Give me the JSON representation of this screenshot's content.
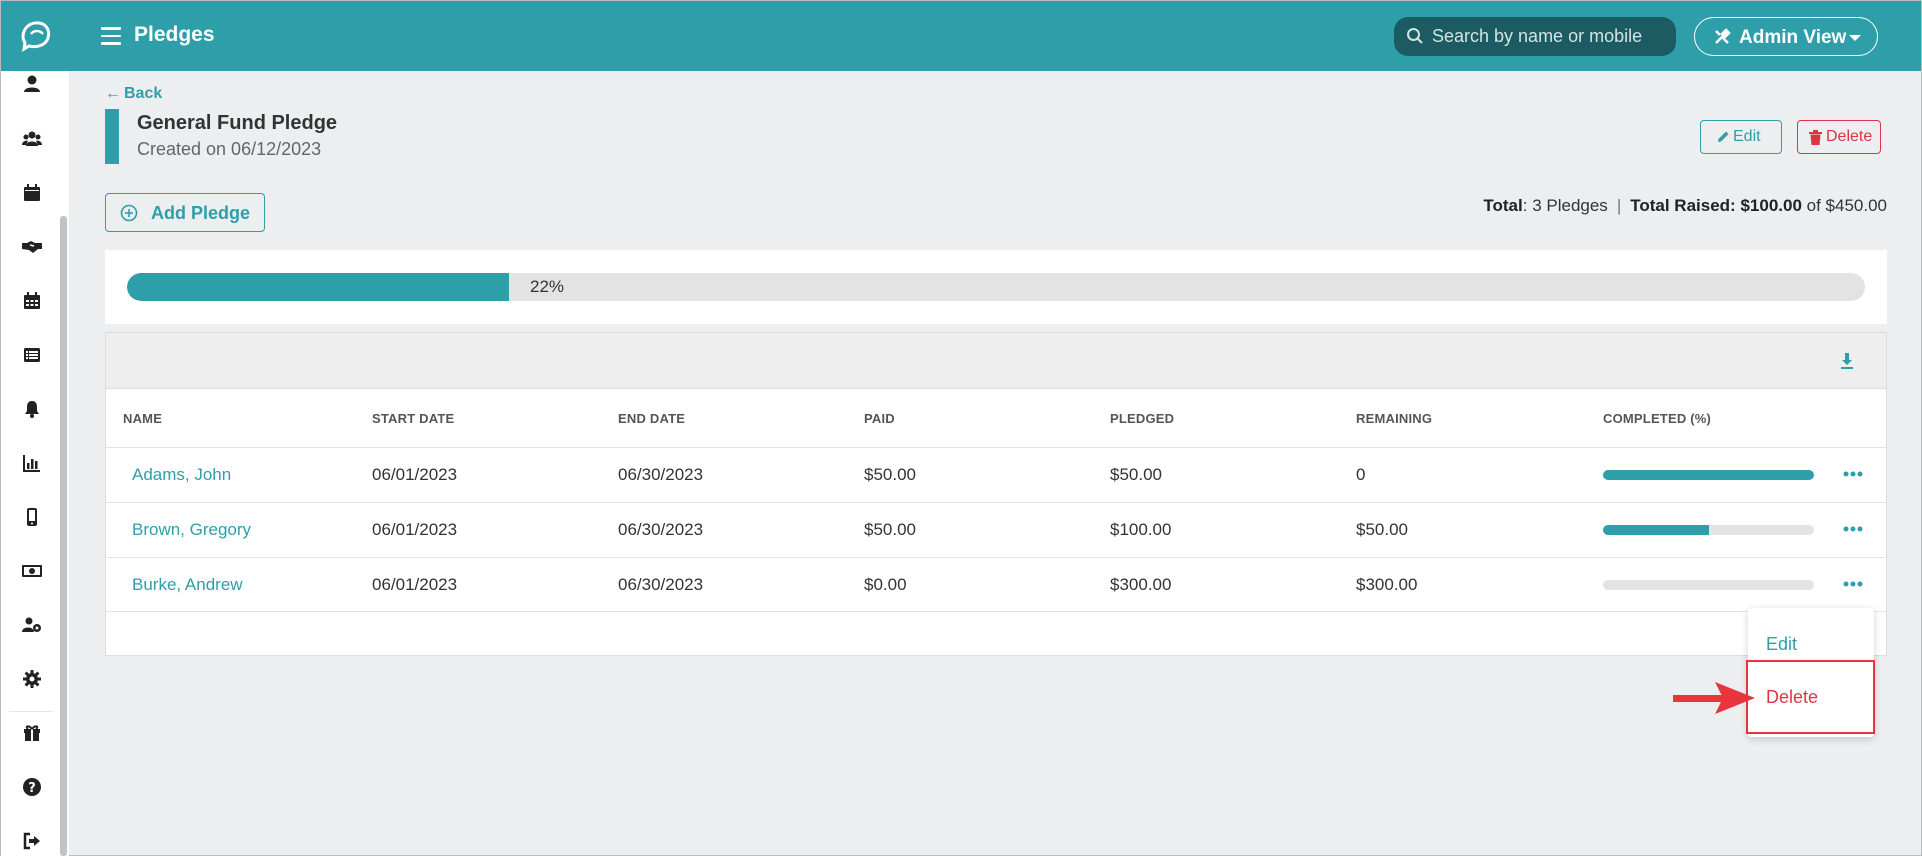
{
  "header": {
    "title": "Pledges",
    "search_placeholder": "Search by name or mobile",
    "admin_view_label": "Admin View"
  },
  "sidebar": {
    "items": [
      {
        "icon": "user-icon"
      },
      {
        "icon": "users-icon"
      },
      {
        "icon": "calendar-icon"
      },
      {
        "icon": "handshake-icon"
      },
      {
        "icon": "calendar-grid-icon"
      },
      {
        "icon": "list-icon"
      },
      {
        "icon": "bell-icon"
      },
      {
        "icon": "chart-icon"
      },
      {
        "icon": "mobile-icon"
      },
      {
        "icon": "money-icon"
      },
      {
        "icon": "user-gear-icon"
      },
      {
        "icon": "settings-icon"
      },
      {
        "icon": "gift-icon"
      },
      {
        "icon": "help-icon"
      },
      {
        "icon": "logout-icon"
      }
    ]
  },
  "page": {
    "back_label": "Back",
    "pledge_title": "General Fund Pledge",
    "created_text": "Created on 06/12/2023",
    "edit_label": "Edit",
    "delete_label": "Delete",
    "add_pledge_label": "Add Pledge",
    "totals": {
      "total_label": "Total",
      "total_value": ": 3 Pledges",
      "separator": "|",
      "raised_label": "Total Raised:",
      "raised_value": "$100.00",
      "of_text": "of $450.00"
    },
    "progress": {
      "percent": 22,
      "label": "22%"
    }
  },
  "table": {
    "columns": [
      "NAME",
      "START DATE",
      "END DATE",
      "PAID",
      "PLEDGED",
      "REMAINING",
      "COMPLETED (%)"
    ],
    "rows": [
      {
        "name": "Adams, John",
        "start": "06/01/2023",
        "end": "06/30/2023",
        "paid": "$50.00",
        "pledged": "$50.00",
        "remaining": "0",
        "completed": 100
      },
      {
        "name": "Brown, Gregory",
        "start": "06/01/2023",
        "end": "06/30/2023",
        "paid": "$50.00",
        "pledged": "$100.00",
        "remaining": "$50.00",
        "completed": 50
      },
      {
        "name": "Burke, Andrew",
        "start": "06/01/2023",
        "end": "06/30/2023",
        "paid": "$0.00",
        "pledged": "$300.00",
        "remaining": "$300.00",
        "completed": 0
      }
    ]
  },
  "row_menu": {
    "edit_label": "Edit",
    "delete_label": "Delete"
  },
  "colors": {
    "brand": "#2e9fa9",
    "danger": "#dc3545",
    "annotation": "#e8343d"
  }
}
